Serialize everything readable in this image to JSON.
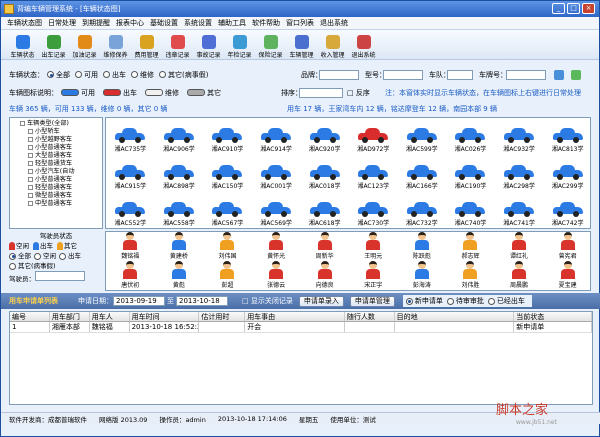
{
  "title": "背编车辆管理系统 - [车辆状态图]",
  "menu": [
    "车辆状态图",
    "日常处理",
    "到期提醒",
    "报表中心",
    "基础设置",
    "系统设置",
    "辅助工具",
    "软件帮助",
    "窗口列表",
    "退出系统"
  ],
  "toolbar": [
    "车辆状态",
    "出车记录",
    "加油记录",
    "维修保养",
    "费用管理",
    "违章记录",
    "事故记录",
    "年检记录",
    "保险记录",
    "车辆管理",
    "收入管理",
    "退出系统"
  ],
  "toolbar_colors": [
    "#2c7be5",
    "#3c9d3c",
    "#e38b19",
    "#7aa4d9",
    "#d9a21f",
    "#e04b4b",
    "#4f6fd6",
    "#3a9bd5",
    "#5fb35f",
    "#4a6fcf",
    "#d7a83a",
    "#c44"
  ],
  "filter": {
    "state_label": "车辆状态：",
    "options": [
      "全部",
      "可用",
      "出车",
      "维修",
      "其它(病事假)"
    ],
    "brand": "品牌：",
    "model": "型号：",
    "team": "车队：",
    "plate": "车牌号："
  },
  "legend": {
    "label": "车辆图标说明：",
    "items": [
      "可用",
      "出车",
      "维修",
      "其它"
    ],
    "sort": "排序：",
    "desc": "□ 反序",
    "note": "注：本窗体实时显示车辆状态，在车辆图标上右键进行日常处理"
  },
  "summary": "车辆 365 辆，可用 133 辆，维修 0 辆，其它 0 辆",
  "summary2": "用车 17 辆，王家湾车内 12 辆，铭达摩登车 12 辆，南园本部 9 辆",
  "tree": [
    "车辆类型(全部)",
    "小型轿车",
    "小型越野客车",
    "小型普通客车",
    "大型普通客车",
    "轻型普通货车",
    "小型汽车(自动",
    "小型普通客车",
    "轻型普通客车",
    "微型普通客车",
    "中型普通客车"
  ],
  "plates": [
    "湘AC735学",
    "湘AC906学",
    "湘AC910学",
    "湘AC914学",
    "湘AC920学",
    "湘AD972学",
    "湘AC599学",
    "湘AC026学",
    "湘AC932学",
    "湘AC813学",
    "湘AC915学",
    "湘AC898学",
    "湘AC150学",
    "湘AC001学",
    "湘AC018学",
    "湘AC123学",
    "湘AC166学",
    "湘AC190学",
    "湘AC298学",
    "湘AC299学",
    "湘AC552学",
    "湘AC558学",
    "湘AC567学",
    "湘AC569学",
    "湘AC618学",
    "湘AC730学",
    "湘AC732学",
    "湘AC740学",
    "湘AC741学",
    "湘AC742学"
  ],
  "car_red_index": 5,
  "drivers": [
    "魏铭福",
    "黄建桥",
    "刘伟国",
    "黄怀光",
    "周新华",
    "王明元",
    "陈跃彪",
    "郝志辉",
    "谭红礼",
    "曾宪君",
    "唐伏初",
    "黄彪",
    "彭超",
    "张德云",
    "向德良",
    "宋正宇",
    "彭海涛",
    "刘伟胜",
    "周晨鹏",
    "夏宝建"
  ],
  "driver_state": {
    "title": "驾驶员状态",
    "items": [
      "空闲",
      "出车",
      "其它"
    ],
    "options": [
      "全部",
      "空闲",
      "出车",
      "其它(病事假)"
    ],
    "label": "驾驶员："
  },
  "request": {
    "title": "用车申请单列表",
    "date_label": "申请日期：",
    "from": "2013-09-19",
    "to": "2013-10-18",
    "show_closed": "显示关闭记录",
    "btn1": "申请单录入",
    "btn2": "申请单管理",
    "opts": [
      "新申请单",
      "待审审批",
      "已经出车"
    ]
  },
  "table": {
    "headers": [
      "编号",
      "用车部门",
      "用车人",
      "用车时间",
      "估计用时",
      "用车事由",
      "随行人数",
      "目的地",
      "当前状态"
    ],
    "row": [
      "1",
      "湘雁本部",
      "魏铭福",
      "2013-10-18 16:52:25",
      "",
      "开会",
      "",
      "",
      "新申请单"
    ]
  },
  "status": [
    "软件开发商：成都普瑞软件",
    "网络版 2013.09",
    "操作员：admin",
    "2013-10-18 17:14:06",
    "星期五",
    "使用单位：测试"
  ],
  "watermark": "脚本之家",
  "watermark2": "www.jb51.net"
}
